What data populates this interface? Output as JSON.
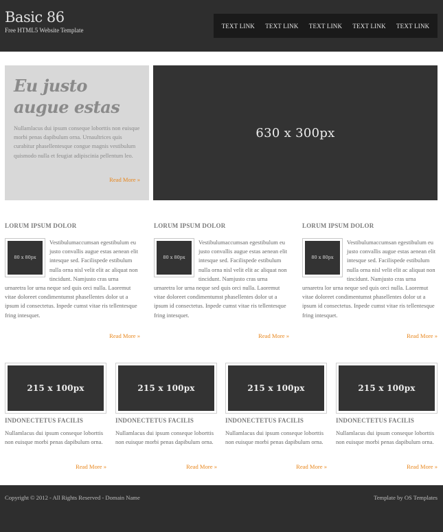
{
  "colors": {
    "header_bg": "#2e2e2e",
    "nav_bg": "#1a1a1a",
    "intro_bg": "#d8d8d8",
    "placeholder_bg": "#333333",
    "accent": "#e8861c",
    "footer_bg": "#2e2e2e"
  },
  "header": {
    "title": "Basic 86",
    "tagline": "Free HTML5 Website Template",
    "nav": [
      "TEXT LINK",
      "TEXT LINK",
      "TEXT LINK",
      "TEXT LINK",
      "TEXT LINK"
    ]
  },
  "intro": {
    "heading": "Eu justo augue estas",
    "text": "Nullamlacus dui ipsum conseque loborttis non euisque morbi penas dapibulum orna. Urnaultrices quis curabitur phasellentesque congue magnis vestibulum quismodo nulla et feugiat adipiscinia pellentum leo.",
    "read_more": "Read More »",
    "hero_label": "630 x 300px"
  },
  "columns": [
    {
      "heading": "LORUM IPSUM DOLOR",
      "thumb_label": "80 x 80px",
      "text": "Vestibulumaccumsan egestibulum eu justo convallis augue estas aenean elit intesque sed. Facilispede estibulum nulla orna nisl velit elit ac aliquat non tincidunt. Namjusto cras urna urnaretra lor urna neque sed quis orci nulla. Laoremut vitae doloreet condimentumst phasellentes dolor ut a ipsum id consectetus. Inpede cumst vitae ris tellentesque fring intesquet.",
      "read_more": "Read More »"
    },
    {
      "heading": "LORUM IPSUM DOLOR",
      "thumb_label": "80 x 80px",
      "text": "Vestibulumaccumsan egestibulum eu justo convallis augue estas aenean elit intesque sed. Facilispede estibulum nulla orna nisl velit elit ac aliquat non tincidunt. Namjusto cras urna urnaretra lor urna neque sed quis orci nulla. Laoremut vitae doloreet condimentumst phasellentes dolor ut a ipsum id consectetus. Inpede cumst vitae ris tellentesque fring intesquet.",
      "read_more": "Read More »"
    },
    {
      "heading": "LORUM IPSUM DOLOR",
      "thumb_label": "80 x 80px",
      "text": "Vestibulumaccumsan egestibulum eu justo convallis augue estas aenean elit intesque sed. Facilispede estibulum nulla orna nisl velit elit ac aliquat non tincidunt. Namjusto cras urna urnaretra lor urna neque sed quis orci nulla. Laoremut vitae doloreet condimentumst phasellentes dolor ut a ipsum id consectetus. Inpede cumst vitae ris tellentesque fring intesquet.",
      "read_more": "Read More »"
    }
  ],
  "boxes": [
    {
      "image_label": "215 x 100px",
      "heading": "INDONECTETUS FACILIS",
      "text": "Nullamlacus dui ipsum conseque loborttis non euisque morbi penas dapibulum orna.",
      "read_more": "Read More »"
    },
    {
      "image_label": "215 x 100px",
      "heading": "INDONECTETUS FACILIS",
      "text": "Nullamlacus dui ipsum conseque loborttis non euisque morbi penas dapibulum orna.",
      "read_more": "Read More »"
    },
    {
      "image_label": "215 x 100px",
      "heading": "INDONECTETUS FACILIS",
      "text": "Nullamlacus dui ipsum conseque loborttis non euisque morbi penas dapibulum orna.",
      "read_more": "Read More »"
    },
    {
      "image_label": "215 x 100px",
      "heading": "INDONECTETUS FACILIS",
      "text": "Nullamlacus dui ipsum conseque loborttis non euisque morbi penas dapibulum orna.",
      "read_more": "Read More »"
    }
  ],
  "footer": {
    "copyright": "Copyright © 2012 - All Rights Reserved - Domain Name",
    "credit": "Template by OS Templates"
  }
}
